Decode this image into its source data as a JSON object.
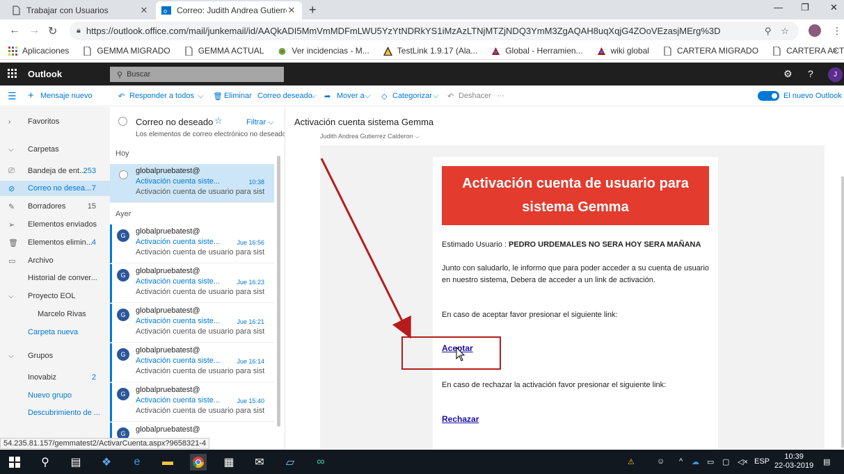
{
  "browser": {
    "tabs": [
      {
        "label": "Trabajar con Usuarios"
      },
      {
        "label": "Correo: Judith Andrea Gutierrez C"
      }
    ],
    "url": "https://outlook.office.com/mail/junkemail/id/AAQkADI5MmVmMDFmLWU5YzYtNDRkYS1iMzAzLTNjMTZjNDQ3YmM3ZgAQAH8uqXqjG4ZOoVEzasjMErg%3D",
    "bookmarks": [
      {
        "label": "Aplicaciones",
        "icon": "apps-grid-icon"
      },
      {
        "label": "GEMMA MIGRADO",
        "icon": "page-icon"
      },
      {
        "label": "GEMMA ACTUAL",
        "icon": "page-icon"
      },
      {
        "label": "Ver incidencias - M...",
        "icon": "bug-icon"
      },
      {
        "label": "TestLink 1.9.17 (Ala...",
        "icon": "testlink-icon"
      },
      {
        "label": "Global - Herramien...",
        "icon": "global-icon"
      },
      {
        "label": "wiki global",
        "icon": "wiki-icon"
      },
      {
        "label": "CARTERA MIGRADO",
        "icon": "page-icon"
      },
      {
        "label": "CARTERA ACTUAL",
        "icon": "page-icon"
      }
    ],
    "bookmarks_more": "»"
  },
  "outlook": {
    "brand": "Outlook",
    "search_placeholder": "Buscar",
    "avatar_initial": "J",
    "commands": {
      "new_message": "Mensaje nuevo",
      "reply_all": "Responder a todos",
      "delete": "Eliminar",
      "junk": "Correo deseado",
      "move": "Mover a",
      "categorize": "Categorizar",
      "undo": "Deshacer",
      "more": "···",
      "new_outlook": "El nuevo Outlook"
    },
    "folders": [
      {
        "label": "Favoritos",
        "count": ""
      },
      {
        "label": "Carpetas",
        "count": ""
      },
      {
        "label": "Bandeja de ent...",
        "count": "253"
      },
      {
        "label": "Correo no desea...",
        "count": "7"
      },
      {
        "label": "Borradores",
        "count": "15"
      },
      {
        "label": "Elementos enviados",
        "count": ""
      },
      {
        "label": "Elementos elimin...",
        "count": "4"
      },
      {
        "label": "Archivo",
        "count": ""
      },
      {
        "label": "Historial de conver...",
        "count": ""
      },
      {
        "label": "Proyecto EOL",
        "count": ""
      },
      {
        "label": "Marcelo Rivas",
        "count": ""
      },
      {
        "label": "Carpeta nueva",
        "count": ""
      },
      {
        "label": "Grupos",
        "count": ""
      },
      {
        "label": "Inovabiz",
        "count": "2"
      },
      {
        "label": "Nuevo grupo",
        "count": ""
      },
      {
        "label": "Descubrimiento de ...",
        "count": ""
      }
    ],
    "list": {
      "title": "Correo no deseado",
      "filter": "Filtrar",
      "subtitle": "Los elementos de correo electrónico no deseado",
      "group_today": "Hoy",
      "group_yesterday": "Ayer",
      "messages": [
        {
          "from": "globalpruebatest@",
          "subject": "Activación cuenta siste...",
          "time": "10:38",
          "preview": "Activación cuenta de usuario para siste...",
          "initial": ""
        },
        {
          "from": "globalpruebatest@",
          "subject": "Activación cuenta siste...",
          "time": "Jue 16:56",
          "preview": "Activación cuenta de usuario para siste...",
          "initial": "G"
        },
        {
          "from": "globalpruebatest@",
          "subject": "Activación cuenta siste...",
          "time": "Jue 16:23",
          "preview": "Activación cuenta de usuario para siste...",
          "initial": "G"
        },
        {
          "from": "globalpruebatest@",
          "subject": "Activación cuenta siste...",
          "time": "Jue 16:21",
          "preview": "Activación cuenta de usuario para siste...",
          "initial": "G"
        },
        {
          "from": "globalpruebatest@",
          "subject": "Activación cuenta siste...",
          "time": "Jue 16:14",
          "preview": "Activación cuenta de usuario para siste...",
          "initial": "G"
        },
        {
          "from": "globalpruebatest@",
          "subject": "Activación cuenta siste...",
          "time": "Jue 15:40",
          "preview": "Activación cuenta de usuario para siste...",
          "initial": "G"
        },
        {
          "from": "globalpruebatest@",
          "subject": "",
          "time": "",
          "preview": "",
          "initial": "G"
        }
      ]
    },
    "reading": {
      "title": "Activación cuenta sistema Gemma",
      "from": "Judith Andrea Gutierrez Calderon",
      "banner_line1": "Activación cuenta de usuario para",
      "banner_line2": "sistema Gemma",
      "greeting_label": "Estimado Usuario : ",
      "greeting_name": "PEDRO URDEMALES NO SERA HOY SERA MAÑANA",
      "para1_line1": "Junto con saludarlo, le informo que para poder acceder a su cuenta de usuario",
      "para1_line2": "en nuestro sistema, Debera de acceder a un link de activación.",
      "accept_text": "En caso de aceptar favor presionar el siguiente link:",
      "accept_link": "Aceptar",
      "reject_text": "En caso de rechazar la activación favor presionar el siguiente link:",
      "reject_link": "Rechazar"
    },
    "status_url": "54.235.81.157/gemmatest2/ActivarCuenta.aspx?9658321-4"
  },
  "taskbar": {
    "lang": "ESP",
    "time": "10:39",
    "date": "22-03-2019"
  },
  "colors": {
    "accent": "#0078d4",
    "banner": "#e33b2e",
    "annotation": "#b71c1c"
  }
}
